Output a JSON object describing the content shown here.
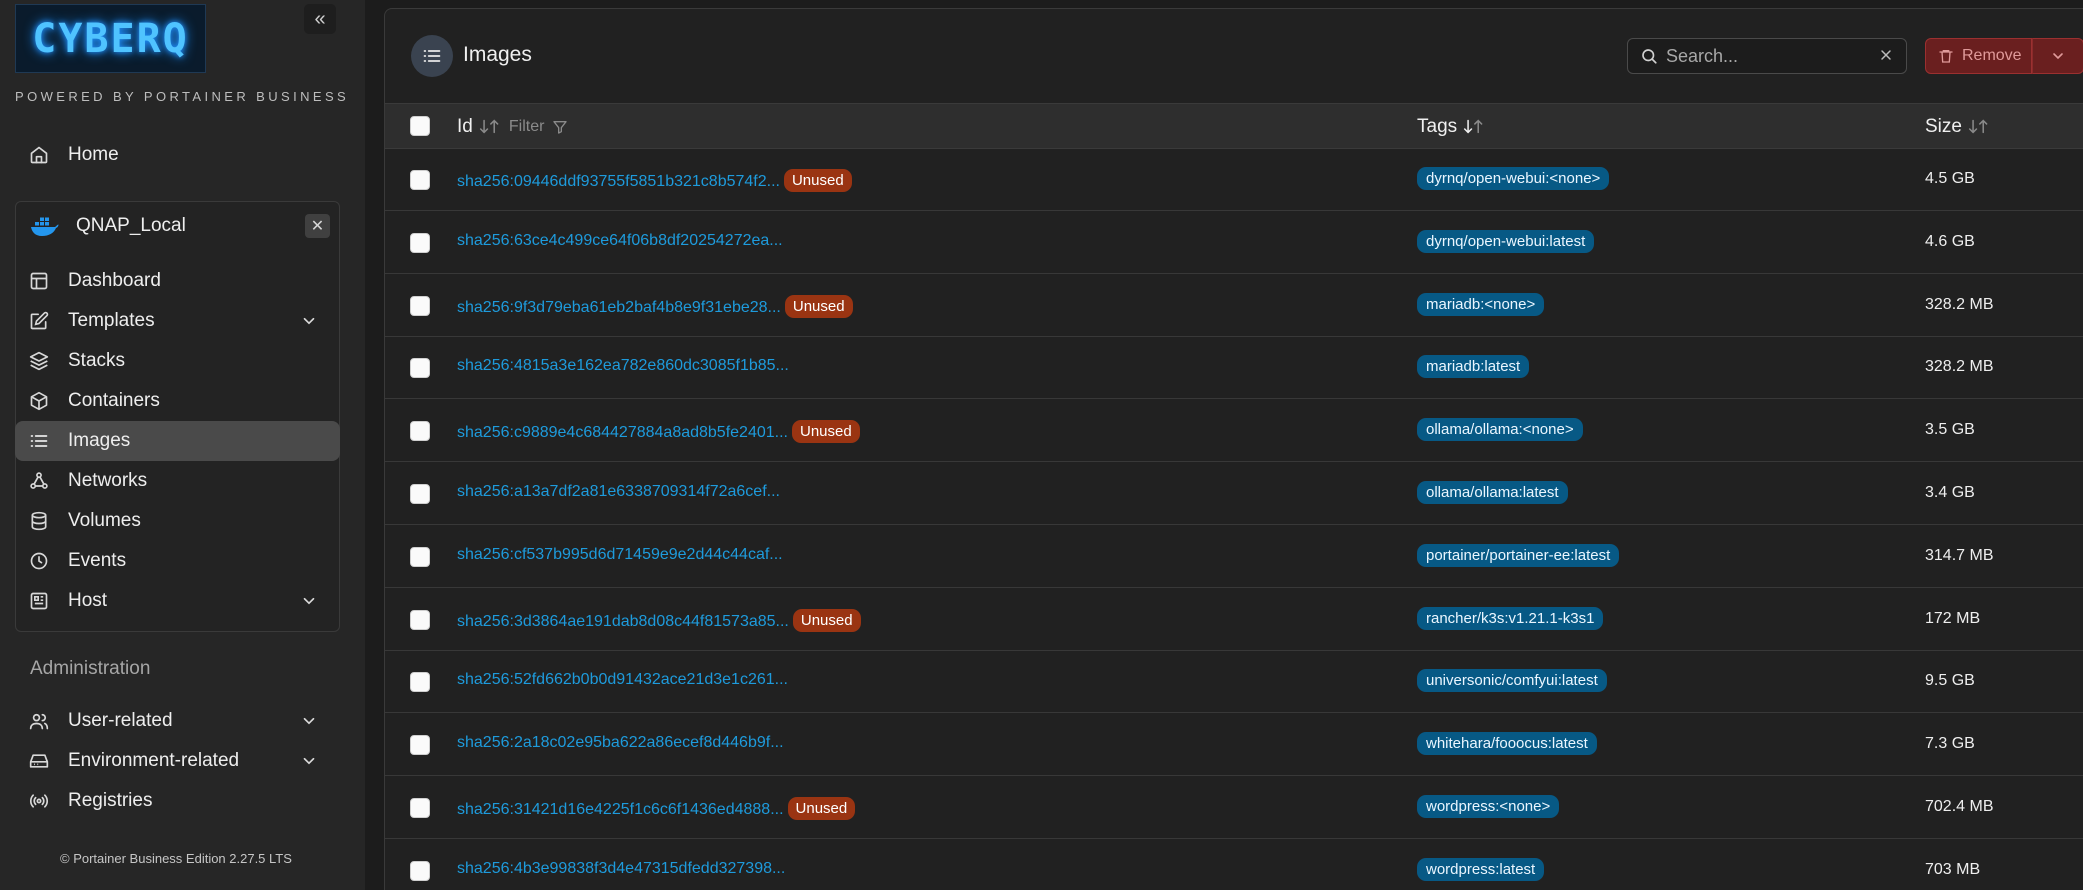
{
  "brand": {
    "logo_text": "CYBERQ",
    "powered_by": "POWERED BY PORTAINER BUSINESS",
    "collapse_label": "«"
  },
  "nav": {
    "home": "Home",
    "environment": {
      "name": "QNAP_Local",
      "close_label": "✕",
      "items": [
        {
          "label": "Dashboard",
          "icon": "dashboard-icon"
        },
        {
          "label": "Templates",
          "icon": "edit-icon",
          "expandable": true
        },
        {
          "label": "Stacks",
          "icon": "layers-icon"
        },
        {
          "label": "Containers",
          "icon": "box-icon"
        },
        {
          "label": "Images",
          "icon": "list-icon",
          "active": true
        },
        {
          "label": "Networks",
          "icon": "network-icon"
        },
        {
          "label": "Volumes",
          "icon": "database-icon"
        },
        {
          "label": "Events",
          "icon": "clock-icon"
        },
        {
          "label": "Host",
          "icon": "host-icon",
          "expandable": true
        }
      ]
    },
    "admin_heading": "Administration",
    "admin_items": [
      {
        "label": "User-related",
        "icon": "users-icon",
        "expandable": true
      },
      {
        "label": "Environment-related",
        "icon": "drive-icon",
        "expandable": true
      },
      {
        "label": "Registries",
        "icon": "radio-icon"
      }
    ]
  },
  "footer": {
    "text": "© Portainer Business Edition  2.27.5 LTS"
  },
  "page": {
    "title": "Images"
  },
  "search": {
    "placeholder": "Search...",
    "value": ""
  },
  "toolbar": {
    "remove_label": "Remove"
  },
  "table": {
    "columns": {
      "id": "Id",
      "filter": "Filter",
      "tags": "Tags",
      "size": "Size"
    },
    "unused_label": "Unused",
    "rows": [
      {
        "id": "sha256:09446ddf93755f5851b321c8b574f2...",
        "unused": true,
        "tag": "dyrnq/open-webui:<none>",
        "size": "4.5 GB"
      },
      {
        "id": "sha256:63ce4c499ce64f06b8df20254272ea...",
        "unused": false,
        "tag": "dyrnq/open-webui:latest",
        "size": "4.6 GB"
      },
      {
        "id": "sha256:9f3d79eba61eb2baf4b8e9f31ebe28...",
        "unused": true,
        "tag": "mariadb:<none>",
        "size": "328.2 MB"
      },
      {
        "id": "sha256:4815a3e162ea782e860dc3085f1b85...",
        "unused": false,
        "tag": "mariadb:latest",
        "size": "328.2 MB"
      },
      {
        "id": "sha256:c9889e4c684427884a8ad8b5fe2401...",
        "unused": true,
        "tag": "ollama/ollama:<none>",
        "size": "3.5 GB"
      },
      {
        "id": "sha256:a13a7df2a81e6338709314f72a6cef...",
        "unused": false,
        "tag": "ollama/ollama:latest",
        "size": "3.4 GB"
      },
      {
        "id": "sha256:cf537b995d6d71459e9e2d44c44caf...",
        "unused": false,
        "tag": "portainer/portainer-ee:latest",
        "size": "314.7 MB"
      },
      {
        "id": "sha256:3d3864ae191dab8d08c44f81573a85...",
        "unused": true,
        "tag": "rancher/k3s:v1.21.1-k3s1",
        "size": "172 MB"
      },
      {
        "id": "sha256:52fd662b0b0d91432ace21d3e1c261...",
        "unused": false,
        "tag": "universonic/comfyui:latest",
        "size": "9.5 GB"
      },
      {
        "id": "sha256:2a18c02e95ba622a86ecef8d446b9f...",
        "unused": false,
        "tag": "whitehara/fooocus:latest",
        "size": "7.3 GB"
      },
      {
        "id": "sha256:31421d16e4225f1c6c6f1436ed4888...",
        "unused": true,
        "tag": "wordpress:<none>",
        "size": "702.4 MB"
      },
      {
        "id": "sha256:4b3e99838f3d4e47315dfedd327398...",
        "unused": false,
        "tag": "wordpress:latest",
        "size": "703 MB"
      }
    ]
  }
}
